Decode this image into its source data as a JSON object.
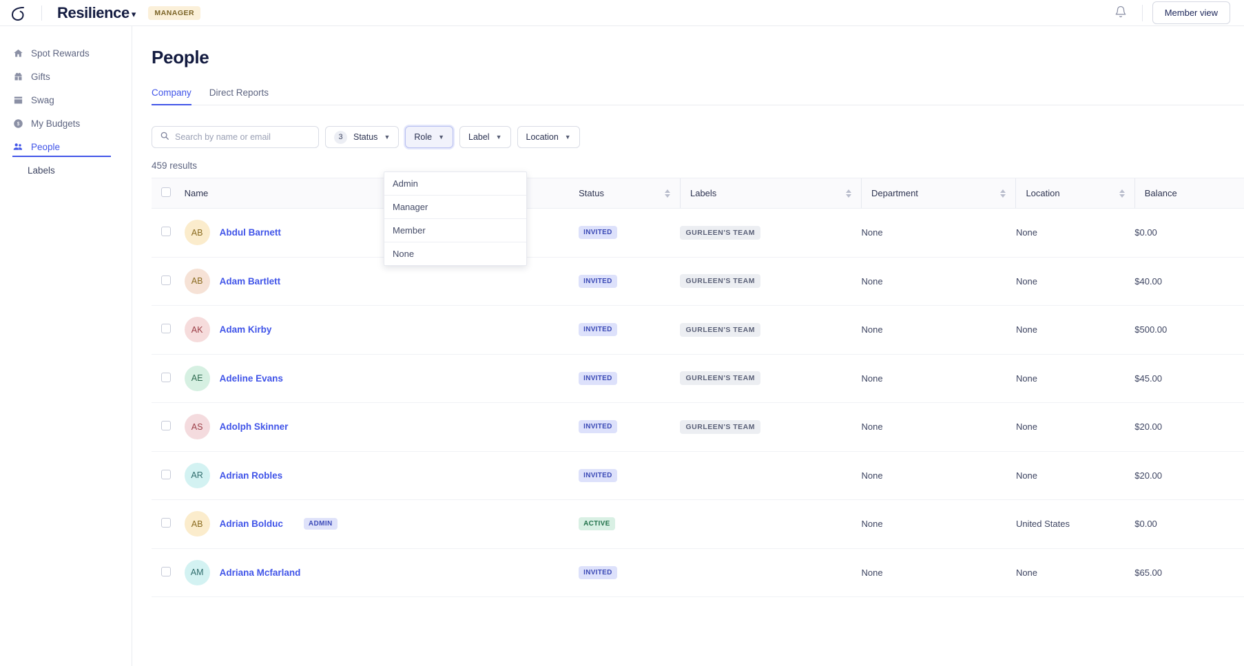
{
  "topbar": {
    "logo_icon": "resilience-leaf-logo",
    "brand_name": "Resilience",
    "brand_caret_icon": "chevron-down-icon",
    "role_badge": "MANAGER",
    "bell_icon": "notification-bell-icon",
    "member_view_label": "Member view"
  },
  "sidebar": {
    "items": [
      {
        "label": "Spot Rewards",
        "icon": "home-icon",
        "active": false
      },
      {
        "label": "Gifts",
        "icon": "gift-icon",
        "active": false
      },
      {
        "label": "Swag",
        "icon": "store-icon",
        "active": false
      },
      {
        "label": "My Budgets",
        "icon": "dollar-coin-icon",
        "active": false
      },
      {
        "label": "People",
        "icon": "people-icon",
        "active": true
      }
    ],
    "sub_items": [
      {
        "label": "Labels"
      }
    ]
  },
  "main": {
    "page_title": "People",
    "tabs": [
      {
        "label": "Company",
        "active": true
      },
      {
        "label": "Direct Reports",
        "active": false
      }
    ],
    "search": {
      "placeholder": "Search by name or email",
      "value": "",
      "icon": "search-icon"
    },
    "filters": [
      {
        "name": "status",
        "label": "Status",
        "count": "3",
        "open": false,
        "icon": "chevron-down-icon"
      },
      {
        "name": "role",
        "label": "Role",
        "count": "",
        "open": true,
        "icon": "chevron-down-icon"
      },
      {
        "name": "label",
        "label": "Label",
        "count": "",
        "open": false,
        "icon": "chevron-down-icon"
      },
      {
        "name": "location",
        "label": "Location",
        "count": "",
        "open": false,
        "icon": "chevron-down-icon"
      }
    ],
    "role_dropdown": {
      "options": [
        "Admin",
        "Manager",
        "Member",
        "None"
      ]
    },
    "results_count": "459 results",
    "table": {
      "columns": [
        {
          "key": "name",
          "label": "Name",
          "sortable": false
        },
        {
          "key": "status",
          "label": "Status",
          "sortable": true
        },
        {
          "key": "labels",
          "label": "Labels",
          "sortable": true
        },
        {
          "key": "department",
          "label": "Department",
          "sortable": true
        },
        {
          "key": "location",
          "label": "Location",
          "sortable": true
        },
        {
          "key": "balance",
          "label": "Balance",
          "sortable": false
        }
      ],
      "rows": [
        {
          "initials": "AB",
          "avatar_bg": "#fbeccc",
          "avatar_fg": "#8a6b20",
          "name": "Abdul Barnett",
          "admin": false,
          "status": "INVITED",
          "status_kind": "invited",
          "label": "GURLEEN'S TEAM",
          "department": "None",
          "location": "None",
          "balance": "$0.00"
        },
        {
          "initials": "AB",
          "avatar_bg": "#f6e2d6",
          "avatar_fg": "#8a6b20",
          "name": "Adam Bartlett",
          "admin": false,
          "status": "INVITED",
          "status_kind": "invited",
          "label": "GURLEEN'S TEAM",
          "department": "None",
          "location": "None",
          "balance": "$40.00"
        },
        {
          "initials": "AK",
          "avatar_bg": "#f6dcdc",
          "avatar_fg": "#9b3d46",
          "name": "Adam Kirby",
          "admin": false,
          "status": "INVITED",
          "status_kind": "invited",
          "label": "GURLEEN'S TEAM",
          "department": "None",
          "location": "None",
          "balance": "$500.00"
        },
        {
          "initials": "AE",
          "avatar_bg": "#d6f0e2",
          "avatar_fg": "#2e6b50",
          "name": "Adeline Evans",
          "admin": false,
          "status": "INVITED",
          "status_kind": "invited",
          "label": "GURLEEN'S TEAM",
          "department": "None",
          "location": "None",
          "balance": "$45.00"
        },
        {
          "initials": "AS",
          "avatar_bg": "#f4dbde",
          "avatar_fg": "#9b3d46",
          "name": "Adolph Skinner",
          "admin": false,
          "status": "INVITED",
          "status_kind": "invited",
          "label": "GURLEEN'S TEAM",
          "department": "None",
          "location": "None",
          "balance": "$20.00"
        },
        {
          "initials": "AR",
          "avatar_bg": "#d3f2f2",
          "avatar_fg": "#2e6b6b",
          "name": "Adrian Robles",
          "admin": false,
          "status": "INVITED",
          "status_kind": "invited",
          "label": "",
          "department": "None",
          "location": "None",
          "balance": "$20.00"
        },
        {
          "initials": "AB",
          "avatar_bg": "#fbeccc",
          "avatar_fg": "#8a6b20",
          "name": "Adrian Bolduc",
          "admin": true,
          "admin_label": "ADMIN",
          "status": "ACTIVE",
          "status_kind": "active",
          "label": "",
          "department": "None",
          "location": "United States",
          "balance": "$0.00"
        },
        {
          "initials": "AM",
          "avatar_bg": "#d3f2f2",
          "avatar_fg": "#2e6b6b",
          "name": "Adriana Mcfarland",
          "admin": false,
          "status": "INVITED",
          "status_kind": "invited",
          "label": "",
          "department": "None",
          "location": "None",
          "balance": "$65.00"
        }
      ]
    }
  },
  "colors": {
    "accent": "#4054e8",
    "brand_dark": "#131b40",
    "badge_manager_bg": "#fbf0d9",
    "status_invited_bg": "#dde1fb",
    "status_active_bg": "#d9f0e4"
  }
}
